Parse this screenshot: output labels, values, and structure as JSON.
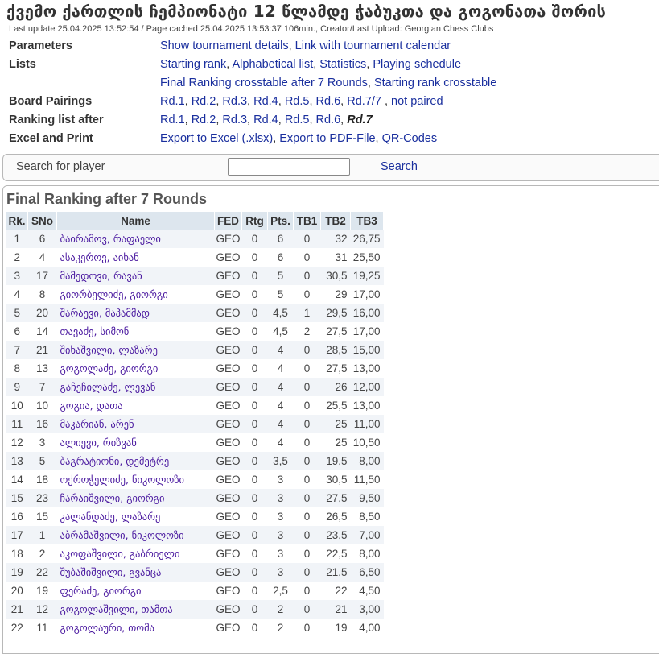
{
  "page": {
    "title": "ქვემო ქართლის ჩემპიონატი 12 წლამდე ჭაბუკთა და გოგონათა შორის",
    "meta": "Last update 25.04.2025 13:52:54 / Page cached 25.04.2025 13:53:37 106min., Creator/Last Upload: Georgian Chess Clubs"
  },
  "info": {
    "parameters": {
      "label": "Parameters",
      "links": [
        "Show tournament details",
        "Link with tournament calendar"
      ]
    },
    "lists": {
      "label": "Lists",
      "links": [
        "Starting rank",
        "Alphabetical list",
        "Statistics",
        "Playing schedule"
      ],
      "links2": [
        "Final Ranking crosstable after 7 Rounds",
        "Starting rank crosstable"
      ]
    },
    "pairings": {
      "label": "Board Pairings",
      "links": [
        "Rd.1",
        "Rd.2",
        "Rd.3",
        "Rd.4",
        "Rd.5",
        "Rd.6",
        "Rd.7/7",
        "not paired"
      ]
    },
    "ranking": {
      "label": "Ranking list after",
      "links": [
        "Rd.1",
        "Rd.2",
        "Rd.3",
        "Rd.4",
        "Rd.5",
        "Rd.6"
      ],
      "current": "Rd.7"
    },
    "excel": {
      "label": "Excel and Print",
      "links": [
        "Export to Excel (.xlsx)",
        "Export to PDF-File",
        "QR-Codes"
      ]
    }
  },
  "search": {
    "label": "Search for player",
    "value": "",
    "button": "Search"
  },
  "ranking": {
    "heading": "Final Ranking after 7 Rounds",
    "columns": [
      "Rk.",
      "SNo",
      "Name",
      "FED",
      "Rtg",
      "Pts.",
      "TB1",
      "TB2",
      "TB3"
    ],
    "rows": [
      [
        "1",
        "6",
        "ბაირამოვ, რაფაელი",
        "GEO",
        "0",
        "6",
        "0",
        "32",
        "26,75"
      ],
      [
        "2",
        "4",
        "ასაკეროვ, აიხან",
        "GEO",
        "0",
        "6",
        "0",
        "31",
        "25,50"
      ],
      [
        "3",
        "17",
        "მამედოვი, რავან",
        "GEO",
        "0",
        "5",
        "0",
        "30,5",
        "19,25"
      ],
      [
        "4",
        "8",
        "გიორბელიძე, გიორგი",
        "GEO",
        "0",
        "5",
        "0",
        "29",
        "17,00"
      ],
      [
        "5",
        "20",
        "შარაევი, მაჰამმად",
        "GEO",
        "0",
        "4,5",
        "1",
        "29,5",
        "16,00"
      ],
      [
        "6",
        "14",
        "თავაძე, სიმონ",
        "GEO",
        "0",
        "4,5",
        "2",
        "27,5",
        "17,00"
      ],
      [
        "7",
        "21",
        "შიხაშვილი, ლაზარე",
        "GEO",
        "0",
        "4",
        "0",
        "28,5",
        "15,00"
      ],
      [
        "8",
        "13",
        "გოგოლაძე, გიორგი",
        "GEO",
        "0",
        "4",
        "0",
        "27,5",
        "13,00"
      ],
      [
        "9",
        "7",
        "გაჩეჩილაძე, ლევან",
        "GEO",
        "0",
        "4",
        "0",
        "26",
        "12,00"
      ],
      [
        "10",
        "10",
        "გოგია, დათა",
        "GEO",
        "0",
        "4",
        "0",
        "25,5",
        "13,00"
      ],
      [
        "11",
        "16",
        "მაკარიან, არენ",
        "GEO",
        "0",
        "4",
        "0",
        "25",
        "11,00"
      ],
      [
        "12",
        "3",
        "ალიევი, რიზვან",
        "GEO",
        "0",
        "4",
        "0",
        "25",
        "10,50"
      ],
      [
        "13",
        "5",
        "ბაგრატიონი, დემეტრე",
        "GEO",
        "0",
        "3,5",
        "0",
        "19,5",
        "8,00"
      ],
      [
        "14",
        "18",
        "ოქროჭელიძე, ნიკოლოზი",
        "GEO",
        "0",
        "3",
        "0",
        "30,5",
        "11,50"
      ],
      [
        "15",
        "23",
        "ჩარაიშვილი, გიორგი",
        "GEO",
        "0",
        "3",
        "0",
        "27,5",
        "9,50"
      ],
      [
        "16",
        "15",
        "კალანდაძე, ლაზარე",
        "GEO",
        "0",
        "3",
        "0",
        "26,5",
        "8,50"
      ],
      [
        "17",
        "1",
        "აბრამაშვილი, ნიკოლოზი",
        "GEO",
        "0",
        "3",
        "0",
        "23,5",
        "7,00"
      ],
      [
        "18",
        "2",
        "აკოფაშვილი, გაბრიელი",
        "GEO",
        "0",
        "3",
        "0",
        "22,5",
        "8,00"
      ],
      [
        "19",
        "22",
        "შუბაშიშვილი, გვანცა",
        "GEO",
        "0",
        "3",
        "0",
        "21,5",
        "6,50"
      ],
      [
        "20",
        "19",
        "ფერაძე, გიორგი",
        "GEO",
        "0",
        "2,5",
        "0",
        "22",
        "4,50"
      ],
      [
        "21",
        "12",
        "გოგოლაშვილი, თამთა",
        "GEO",
        "0",
        "2",
        "0",
        "21",
        "3,00"
      ],
      [
        "22",
        "11",
        "გოგოლაური, თომა",
        "GEO",
        "0",
        "2",
        "0",
        "19",
        "4,00"
      ]
    ]
  }
}
